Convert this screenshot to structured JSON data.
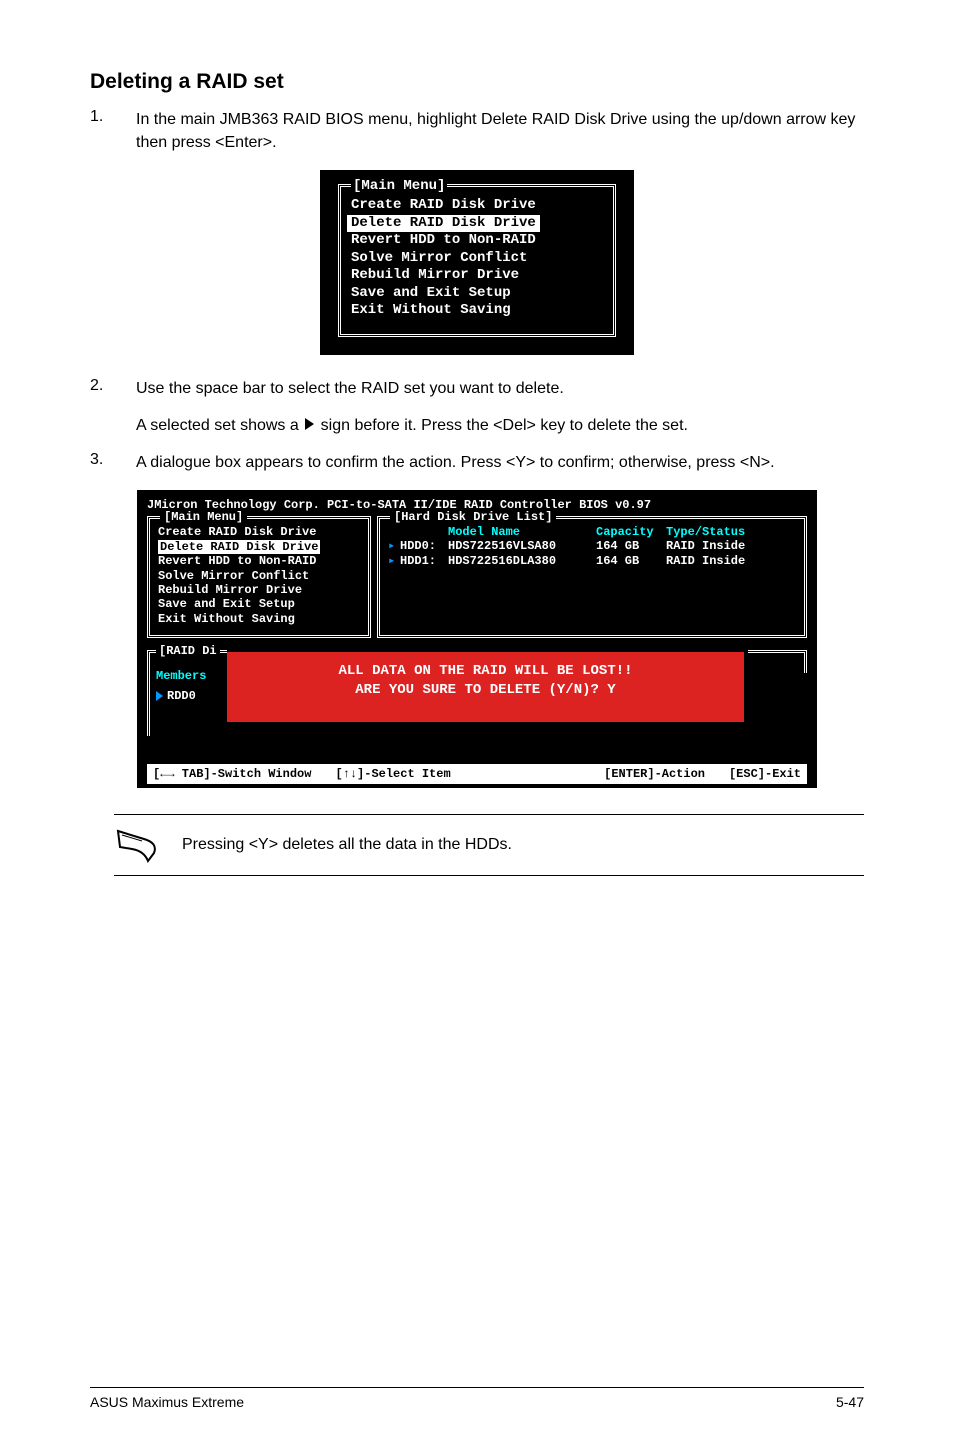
{
  "heading": "Deleting a RAID set",
  "steps": {
    "s1_num": "1.",
    "s1_txt": "In the main JMB363 RAID BIOS menu, highlight Delete RAID Disk Drive using the up/down arrow key then press <Enter>.",
    "s2_num": "2.",
    "s2_txt": "Use the space bar to select the RAID set you want to delete.",
    "s2_cont_a": "A selected set shows a ",
    "s2_cont_b": " sign before it. Press the <Del> key to delete the set.",
    "s3_num": "3.",
    "s3_txt": "A dialogue box appears to confirm the action. Press <Y> to confirm; otherwise, press <N>."
  },
  "main_menu": {
    "title": "[Main Menu]",
    "items": [
      "Create RAID Disk Drive",
      "Delete RAID Disk Drive",
      "Revert HDD to Non-RAID",
      "Solve Mirror Conflict",
      "Rebuild Mirror Drive",
      "Save and Exit Setup",
      "Exit Without Saving"
    ],
    "selected_index": 1
  },
  "bios": {
    "header": "JMicron Technology Corp. PCI-to-SATA II/IDE RAID Controller BIOS v0.97",
    "left_title": "[Main Menu]",
    "right_title": "[Hard Disk Drive List]",
    "left_items": [
      "Create RAID Disk Drive",
      "Delete RAID Disk Drive",
      "Revert HDD to Non-RAID",
      "Solve Mirror Conflict",
      "Rebuild Mirror Drive",
      "Save and Exit Setup",
      "Exit Without Saving"
    ],
    "left_selected_index": 1,
    "hdd_header": {
      "model": "Model Name",
      "capacity": "Capacity",
      "type": "Type/Status"
    },
    "hdds": [
      {
        "slot": "HDD0:",
        "model": "HDS722516VLSA80",
        "capacity": "164 GB",
        "type": "RAID Inside"
      },
      {
        "slot": "HDD1:",
        "model": "HDS722516DLA380",
        "capacity": "164 GB",
        "type": "RAID Inside"
      }
    ],
    "raid_title": "[RAID Di",
    "members_label": "Members",
    "rdd0": "RDD0",
    "alert_line1": "ALL DATA ON THE RAID WILL BE LOST!!",
    "alert_line2": "ARE YOU SURE TO DELETE (Y/N)? Y",
    "footer": {
      "tab": "[←→ TAB]-Switch Window",
      "select": "[↑↓]-Select Item",
      "action": "[ENTER]-Action",
      "exit": "[ESC]-Exit"
    }
  },
  "note": "Pressing <Y> deletes all the data in the HDDs.",
  "footer_left": "ASUS Maximus Extreme",
  "footer_right": "5-47"
}
